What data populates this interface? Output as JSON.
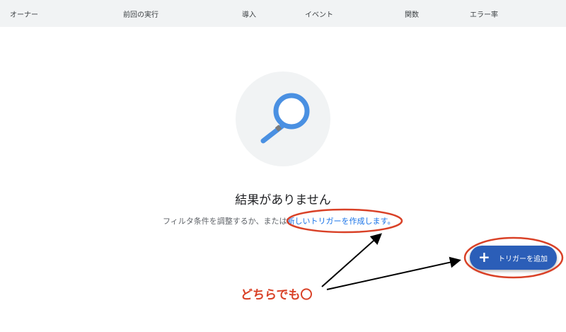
{
  "table_header": {
    "columns": [
      "オーナー",
      "前回の実行",
      "導入",
      "イベント",
      "関数",
      "エラー率"
    ]
  },
  "empty_state": {
    "icon": "search-icon",
    "title": "結果がありません",
    "description_prefix": "フィルタ条件を調整するか、または",
    "create_link": "新しいトリガーを作成します。"
  },
  "fab": {
    "icon": "plus-icon",
    "label": "トリガーを追加"
  },
  "annotation": {
    "text": "どちらでも〇",
    "color": "#d94127"
  },
  "colors": {
    "accent": "#1a73e8",
    "fab": "#2b5eb8",
    "annotation": "#d94127"
  }
}
